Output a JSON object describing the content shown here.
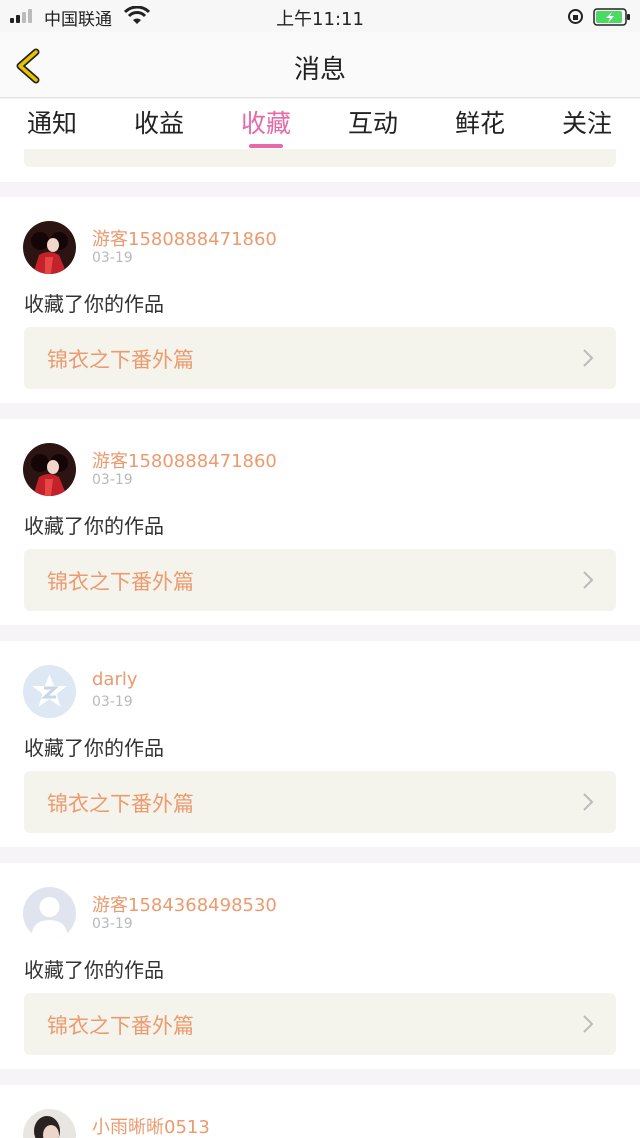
{
  "status_bar": {
    "carrier": "中国联通",
    "time": "上午11:11"
  },
  "header": {
    "title": "消息"
  },
  "tabs": [
    {
      "label": "通知",
      "active": false
    },
    {
      "label": "收益",
      "active": false
    },
    {
      "label": "收藏",
      "active": true
    },
    {
      "label": "互动",
      "active": false
    },
    {
      "label": "鲜花",
      "active": false
    },
    {
      "label": "关注",
      "active": false
    }
  ],
  "messages": [
    {
      "user": "游客1580888471860",
      "date": "03-19",
      "action": "收藏了你的作品",
      "work": "锦衣之下番外篇",
      "avatar": "costume-photo"
    },
    {
      "user": "游客1580888471860",
      "date": "03-19",
      "action": "收藏了你的作品",
      "work": "锦衣之下番外篇",
      "avatar": "costume-photo"
    },
    {
      "user": "darly",
      "date": "03-19",
      "action": "收藏了你的作品",
      "work": "锦衣之下番外篇",
      "avatar": "qzone-star"
    },
    {
      "user": "游客1584368498530",
      "date": "03-19",
      "action": "收藏了你的作品",
      "work": "锦衣之下番外篇",
      "avatar": "default-user"
    },
    {
      "user": "小雨晰晰0513",
      "avatar": "photo"
    }
  ],
  "colors": {
    "accent": "#e66aa8",
    "name": "#ec9a6e",
    "work_bg": "#f5f4ec",
    "back_icon": "#e8c400"
  }
}
